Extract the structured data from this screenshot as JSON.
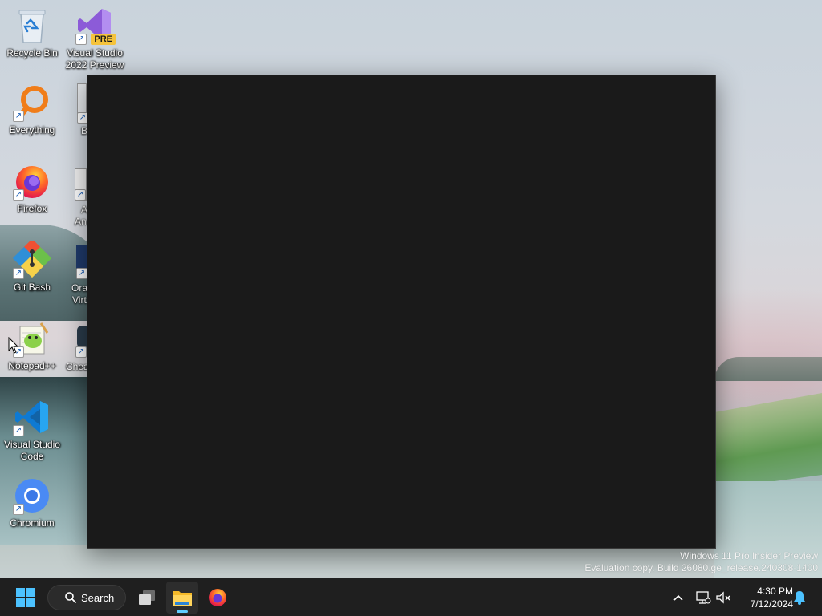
{
  "desktop": {
    "icons": [
      {
        "label": "Recycle Bin",
        "icon": "recycle-bin-icon"
      },
      {
        "label": "Visual Studio 2022 Preview",
        "icon": "visual-studio-icon",
        "badge": "PRE"
      },
      {
        "label": "Everything",
        "icon": "everything-search-icon"
      },
      {
        "label": "Firefox",
        "icon": "firefox-icon"
      },
      {
        "label": "Git Bash",
        "icon": "git-bash-icon"
      },
      {
        "label": "Notepad++",
        "icon": "notepad-plus-plus-icon"
      },
      {
        "label": "Visual Studio Code",
        "icon": "vscode-icon"
      },
      {
        "label": "Chromium",
        "icon": "chromium-icon"
      }
    ],
    "partial_labels": [
      "B",
      "A",
      "An",
      "Ora",
      "Virt",
      "Chea"
    ]
  },
  "watermark": {
    "line1": "Windows 11 Pro Insider Preview",
    "line2": "Evaluation copy. Build 26080.ge_release.240308-1400"
  },
  "taskbar": {
    "search_label": "Search",
    "pinned": [
      "start-icon",
      "task-view-icon",
      "file-explorer-icon",
      "firefox-icon"
    ],
    "tray": {
      "time": "4:30 PM",
      "date": "7/12/2024"
    }
  },
  "colors": {
    "taskbar_bg": "#1f1f1f",
    "window_bg": "#1a1a1a",
    "accent": "#60cdff"
  }
}
